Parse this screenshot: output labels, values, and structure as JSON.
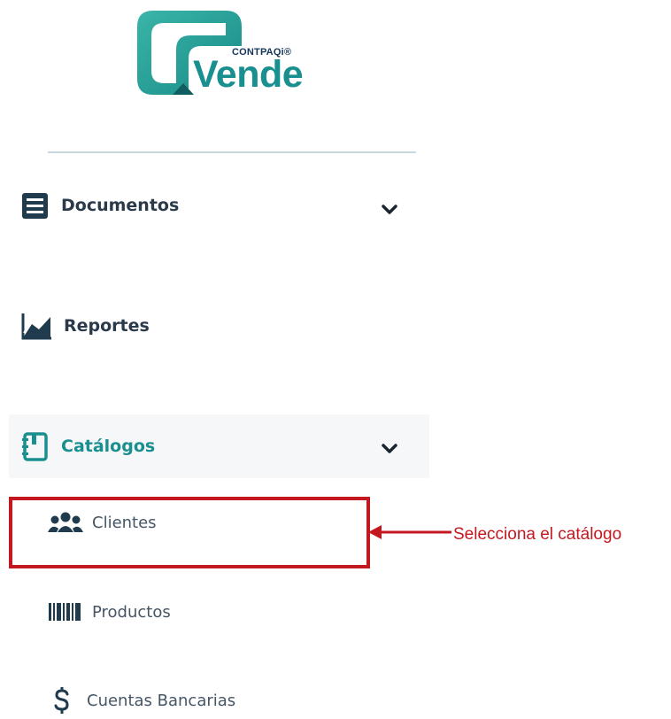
{
  "logo": {
    "brand_small": "CONTPAQi®",
    "brand_big": "Vende"
  },
  "sidebar": {
    "documents": {
      "label": "Documentos",
      "icon": "document-list-icon",
      "expanded": false
    },
    "reports": {
      "label": "Reportes",
      "icon": "chart-line-icon"
    },
    "catalogs": {
      "label": "Catálogos",
      "icon": "notebook-icon",
      "expanded": true,
      "items": [
        {
          "label": "Clientes",
          "icon": "users-icon"
        },
        {
          "label": "Productos",
          "icon": "barcode-icon"
        },
        {
          "label": "Cuentas Bancarias",
          "icon": "dollar-icon"
        }
      ]
    }
  },
  "annotation": {
    "text": "Selecciona el catálogo",
    "color": "#c41820"
  },
  "colors": {
    "accent": "#1a8f8f",
    "dark": "#2a3a4a",
    "highlight": "#c41820"
  }
}
